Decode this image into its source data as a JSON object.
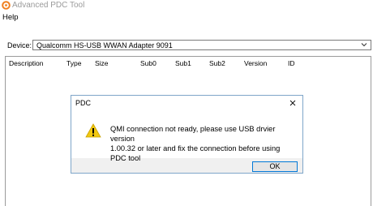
{
  "window": {
    "title": "Advanced PDC Tool",
    "icon": "orange-ring-app-icon"
  },
  "menu": {
    "help": "Help"
  },
  "device": {
    "label": "Device:",
    "value": "Qualcomm HS-USB WWAN Adapter 9091"
  },
  "table": {
    "columns": [
      "Description",
      "Type",
      "Size",
      "Sub0",
      "Sub1",
      "Sub2",
      "Version",
      "ID"
    ]
  },
  "dialog": {
    "title": "PDC",
    "message_line1": "QMI connection not ready, please use USB drvier version",
    "message_line2": "1.00.32 or later and fix the connection before using PDC tool",
    "ok": "OK",
    "icon": "warning-icon"
  },
  "colors": {
    "accent": "#0078d7",
    "warning": "#f2c811",
    "app_icon": "#f08020"
  }
}
